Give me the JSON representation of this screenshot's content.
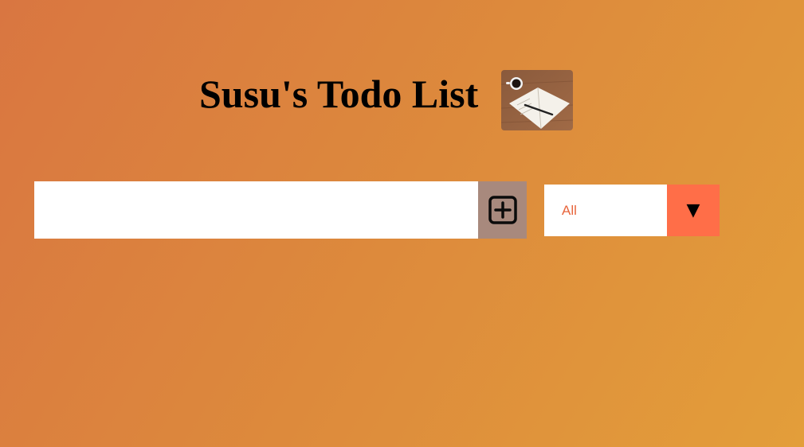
{
  "header": {
    "title": "Susu's Todo List",
    "logo_icon": "notebook-coffee-photo-icon"
  },
  "todo_form": {
    "input_value": "",
    "input_placeholder": "",
    "add_button_icon": "plus-square-icon"
  },
  "filter": {
    "selected": "All",
    "arrow_glyph": "▼",
    "arrow_icon": "caret-down-icon"
  },
  "colors": {
    "background_start": "#d97641",
    "background_end": "#e39e3a",
    "add_button_bg": "#a8897d",
    "filter_arrow_bg": "#ff6e48",
    "filter_text": "#e8653c"
  }
}
